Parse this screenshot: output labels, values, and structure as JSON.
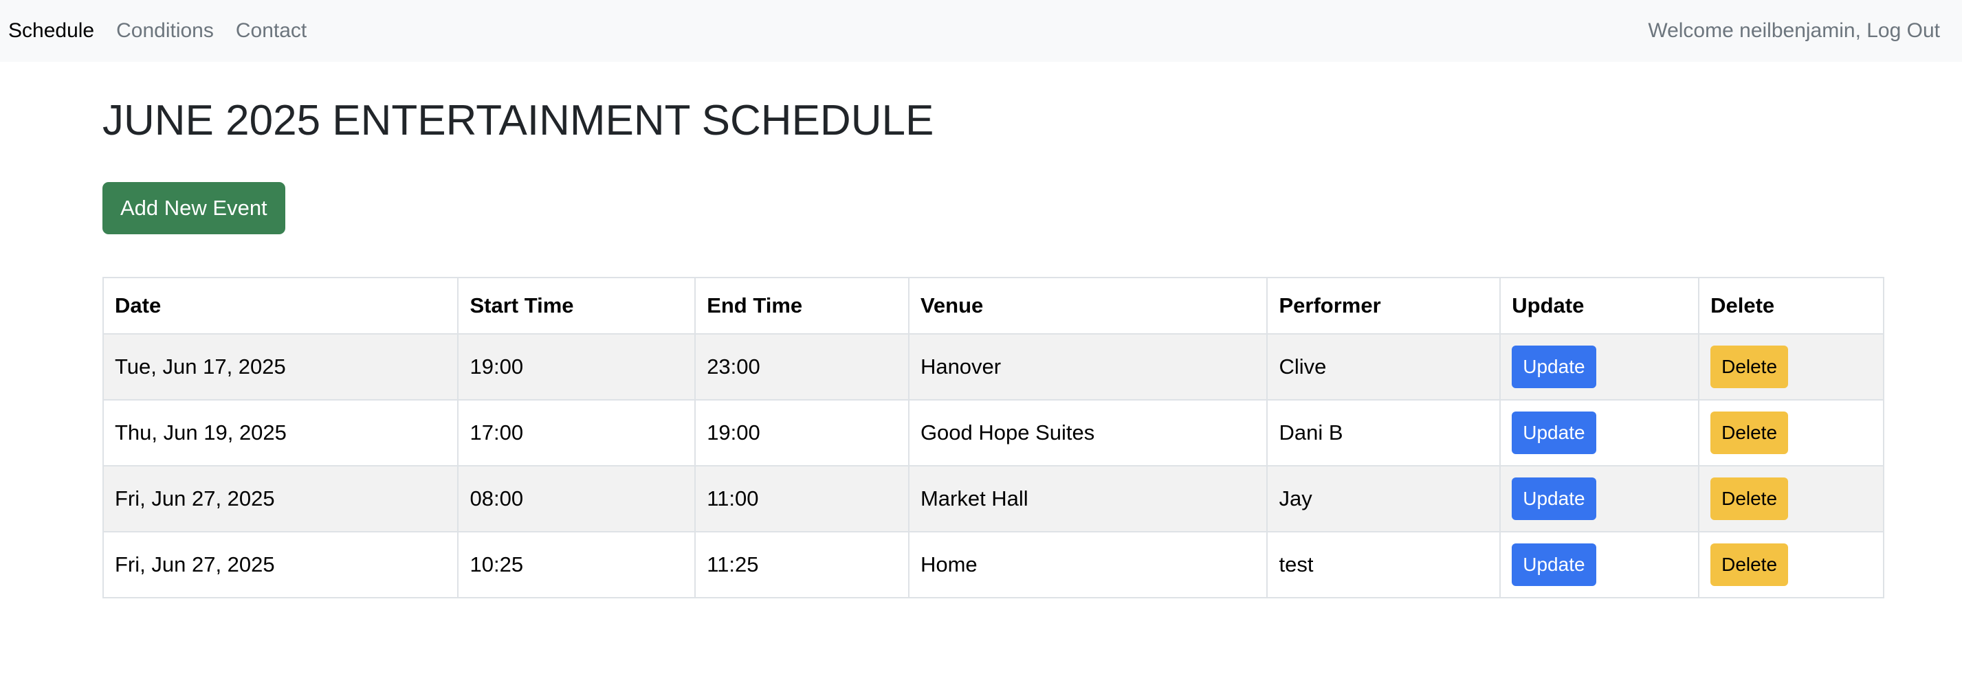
{
  "nav": {
    "links": [
      {
        "label": "Schedule",
        "active": true
      },
      {
        "label": "Conditions",
        "active": false
      },
      {
        "label": "Contact",
        "active": false
      }
    ],
    "welcome": "Welcome neilbenjamin, Log Out"
  },
  "page": {
    "title": "JUNE 2025 ENTERTAINMENT SCHEDULE",
    "add_button": "Add New Event"
  },
  "table": {
    "headers": [
      "Date",
      "Start Time",
      "End Time",
      "Venue",
      "Performer",
      "Update",
      "Delete"
    ],
    "rows": [
      {
        "date": "Tue, Jun 17, 2025",
        "start": "19:00",
        "end": "23:00",
        "venue": "Hanover",
        "performer": "Clive",
        "update": "Update",
        "delete": "Delete"
      },
      {
        "date": "Thu, Jun 19, 2025",
        "start": "17:00",
        "end": "19:00",
        "venue": "Good Hope Suites",
        "performer": "Dani B",
        "update": "Update",
        "delete": "Delete"
      },
      {
        "date": "Fri, Jun 27, 2025",
        "start": "08:00",
        "end": "11:00",
        "venue": "Market Hall",
        "performer": "Jay",
        "update": "Update",
        "delete": "Delete"
      },
      {
        "date": "Fri, Jun 27, 2025",
        "start": "10:25",
        "end": "11:25",
        "venue": "Home",
        "performer": "test",
        "update": "Update",
        "delete": "Delete"
      }
    ]
  },
  "colors": {
    "navbar_bg": "#f8f9fa",
    "add_button": "#3a8152",
    "update_button": "#3674ef",
    "delete_button": "#f4c243"
  }
}
